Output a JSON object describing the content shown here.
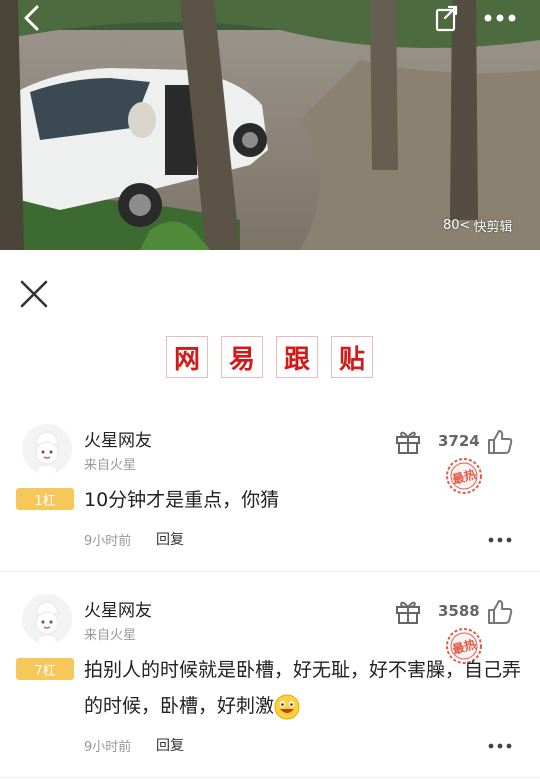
{
  "video": {
    "watermark": "快剪辑",
    "watermark_logo": "80<"
  },
  "brand": {
    "chars": [
      "网",
      "易",
      "跟",
      "贴"
    ]
  },
  "comments": [
    {
      "user": "火星网友",
      "location": "来自火星",
      "floor": "1杠",
      "text": "10分钟才是重点，你猜",
      "time": "9小时前",
      "reply": "回复",
      "likes": "3724",
      "hot_badge": "最热"
    },
    {
      "user": "火星网友",
      "location": "来自火星",
      "floor": "7杠",
      "text": "拍别人的时候就是卧槽，好无耻，好不害臊，自己弄的时候，卧槽，好刺激",
      "time": "9小时前",
      "reply": "回复",
      "likes": "3588",
      "hot_badge": "最热"
    }
  ],
  "icons": {
    "back": "chevron-left-icon",
    "share": "share-icon",
    "more": "more-horizontal-icon",
    "close": "close-icon",
    "gift": "gift-icon",
    "like": "thumbs-up-icon",
    "hot": "hot-stamp-icon",
    "emoji": "grinning-face-icon"
  },
  "colors": {
    "brand_red": "#d51818",
    "floor_badge": "#f6c85a",
    "hot_stamp": "#e25a4a"
  }
}
